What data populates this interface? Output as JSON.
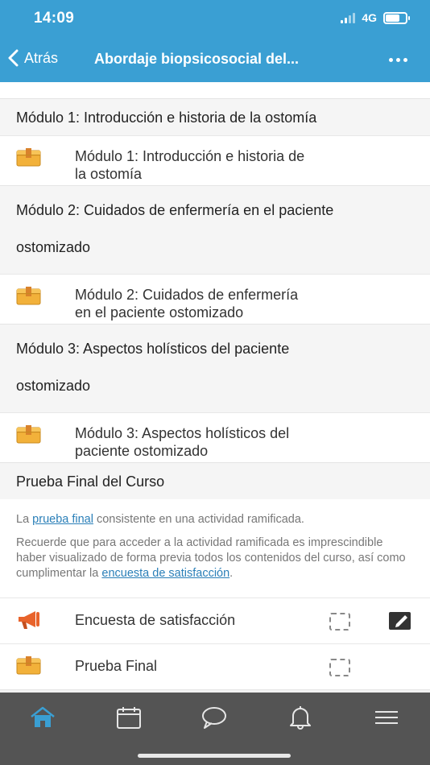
{
  "status_bar": {
    "time": "14:09",
    "network": "4G"
  },
  "nav": {
    "back_label": "Atrás",
    "title": "Abordaje biopsicosocial del..."
  },
  "sections": [
    {
      "header_lines": [
        "Módulo 1: Introducción e historia de la ostomía"
      ],
      "module_lines": [
        "Módulo 1: Introducción e historia de",
        "la ostomía"
      ]
    },
    {
      "header_lines": [
        "Módulo 2: Cuidados de enfermería en el paciente",
        "ostomizado"
      ],
      "module_lines": [
        "Módulo 2: Cuidados de enfermería",
        "en el paciente ostomizado"
      ]
    },
    {
      "header_lines": [
        "Módulo 3: Aspectos holísticos del paciente",
        "ostomizado"
      ],
      "module_lines": [
        "Módulo 3: Aspectos holísticos del",
        "paciente ostomizado"
      ]
    }
  ],
  "final_section": {
    "header": "Prueba Final del Curso",
    "summary": {
      "p1_before": "La ",
      "p1_link": "prueba final",
      "p1_after": " consistente en una actividad ramificada.",
      "p2_before": "Recuerde que para acceder a la actividad ramificada es imprescindible haber visualizado de forma previa todos los contenidos del curso, así como cumplimentar la ",
      "p2_link": "encuesta de satisfacción",
      "p2_after": "."
    },
    "activities": [
      {
        "label": "Encuesta de satisfacción",
        "icon": "megaphone-icon"
      },
      {
        "label": "Prueba Final",
        "icon": "package-icon"
      }
    ]
  },
  "bottom_nav": {
    "items": [
      "home-icon",
      "calendar-icon",
      "chat-icon",
      "bell-icon",
      "menu-icon"
    ],
    "active_color": "#3a9fd3"
  },
  "colors": {
    "brand": "#3a9fd3",
    "link": "#2a7fb8",
    "module_icon": "#f2b13a",
    "megaphone": "#e8632b"
  }
}
